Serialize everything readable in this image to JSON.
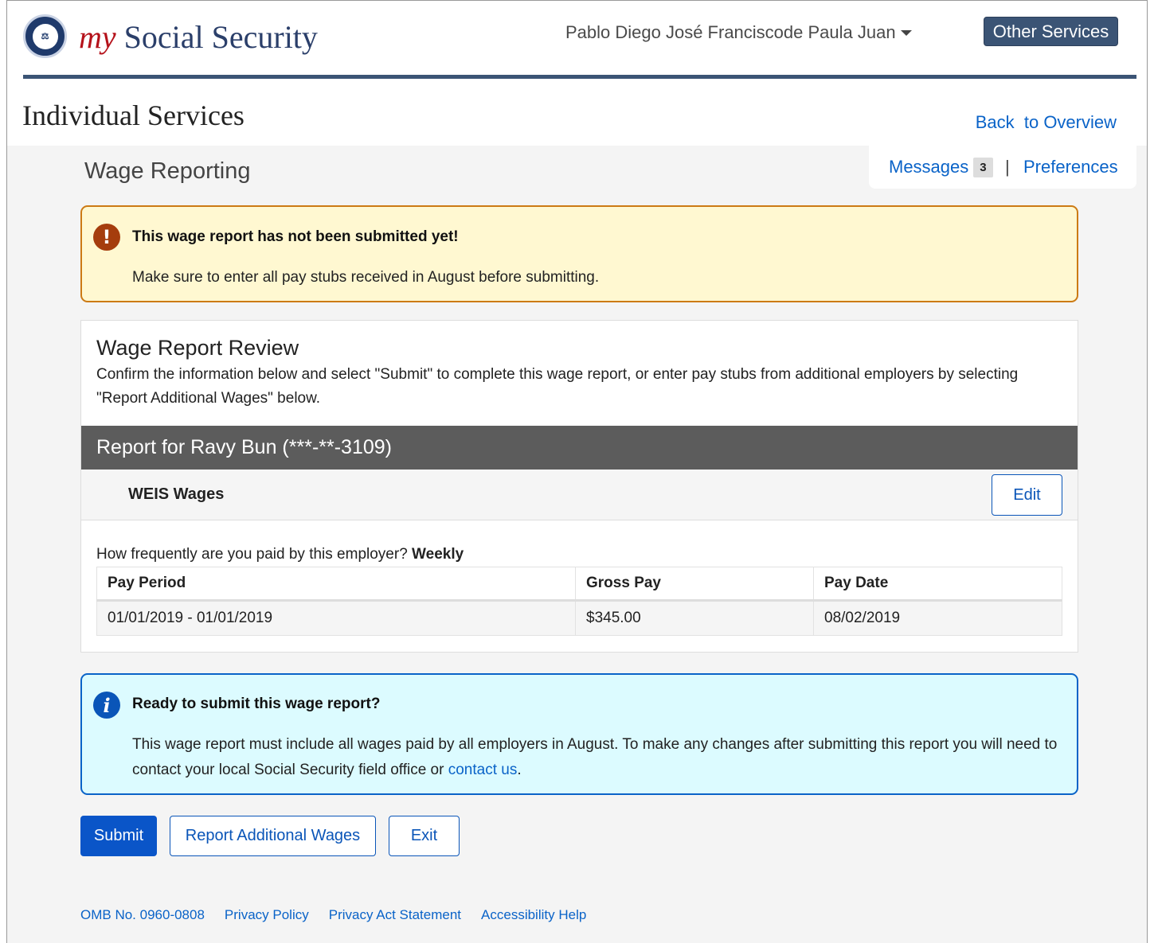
{
  "header": {
    "brand_my": "my",
    "brand_name": "Social Security",
    "user_name": "Pablo Diego José Franciscode Paula Juan",
    "other_services": "Other Services"
  },
  "subheader": {
    "title": "Individual Services",
    "back_link": "Back  to Overview"
  },
  "nav": {
    "messages_label": "Messages",
    "messages_count": "3",
    "separator": "|",
    "preferences_label": "Preferences"
  },
  "page": {
    "heading": "Wage Reporting"
  },
  "warning_alert": {
    "title": "This wage report has not been submitted yet!",
    "body": "Make sure to enter all pay stubs received in August before submitting."
  },
  "review": {
    "title": "Wage Report Review",
    "description": "Confirm the information below and select \"Submit\" to complete this wage report, or enter pay stubs from additional employers by selecting \"Report Additional Wages\" below.",
    "report_for": "Report for Ravy Bun (***-**-3109)",
    "employer_name": "WEIS Wages",
    "edit_label": "Edit",
    "frequency_question": "How frequently are you paid by this employer?",
    "frequency_value": "Weekly",
    "table": {
      "headers": [
        "Pay Period",
        "Gross Pay",
        "Pay Date"
      ],
      "rows": [
        [
          "01/01/2019 - 01/01/2019",
          "$345.00",
          "08/02/2019"
        ]
      ]
    }
  },
  "info_alert": {
    "title": "Ready to submit this wage report?",
    "body": "This wage report must include all wages paid by all employers in August. To make any changes after submitting this report you will need to contact your local Social Security field office or",
    "link": "contact us",
    "trailing": "."
  },
  "actions": {
    "submit": "Submit",
    "report_additional": "Report Additional Wages",
    "exit": "Exit"
  },
  "footer": {
    "links": [
      "OMB No. 0960-0808",
      "Privacy Policy",
      "Privacy Act Statement",
      "Accessibility Help"
    ]
  },
  "colors": {
    "brand_navy": "#3b5475",
    "brand_red": "#b5121b",
    "link_blue": "#0a63c8",
    "warning_border": "#cc7a14",
    "warning_bg": "#fff8d1",
    "info_border": "#0a63c8",
    "info_bg": "#dcfbff",
    "report_bar": "#5c5c5c"
  },
  "icons": {
    "seal": "ssa-seal-icon",
    "warning": "exclamation-circle-icon",
    "info": "info-circle-icon",
    "dropdown": "caret-down-icon"
  }
}
